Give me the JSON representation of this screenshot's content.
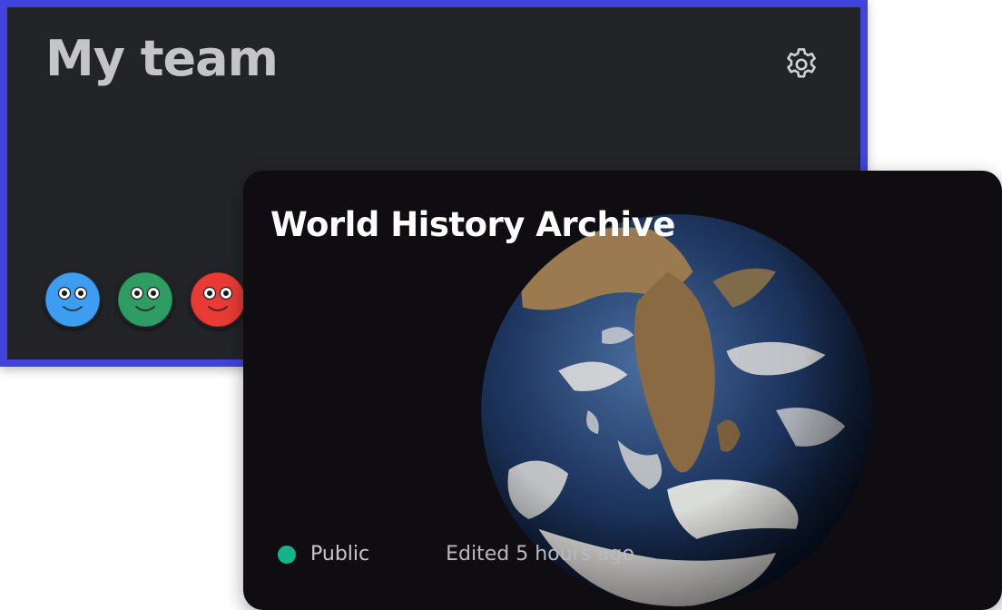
{
  "team": {
    "title": "My team",
    "settings_icon": "gear-icon",
    "accent_color": "#4043dc",
    "avatars": [
      {
        "name": "avatar-blue",
        "color": "#3d9ef1"
      },
      {
        "name": "avatar-green",
        "color": "#2f9c63"
      },
      {
        "name": "avatar-red",
        "color": "#e83b35"
      }
    ]
  },
  "archive": {
    "title": "World History Archive",
    "image": "earth-globe-image",
    "visibility": "Public",
    "visibility_color": "#14b38a",
    "edited": "Edited 5 hours ago"
  }
}
